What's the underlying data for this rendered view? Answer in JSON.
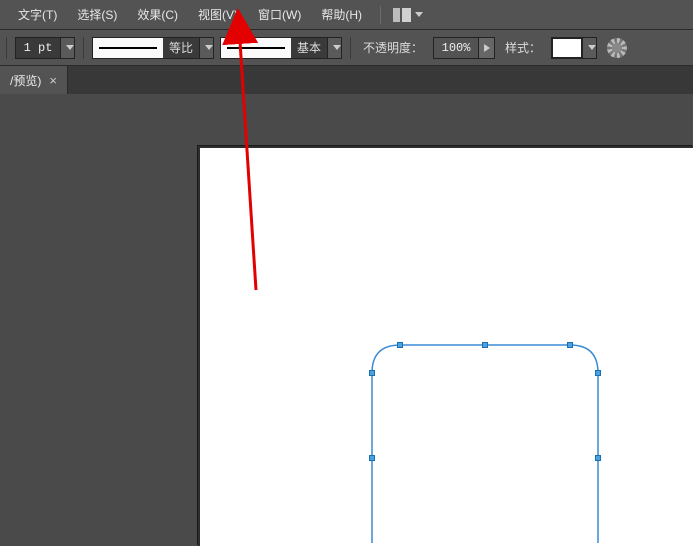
{
  "menu": {
    "items": [
      "文字(T)",
      "选择(S)",
      "效果(C)",
      "视图(V)",
      "窗口(W)",
      "帮助(H)"
    ]
  },
  "options": {
    "stroke_width": "1 pt",
    "dash1_label": "等比",
    "dash2_label": "基本",
    "opacity_label": "不透明度：",
    "opacity_value": "100%",
    "style_label": "样式："
  },
  "tab": {
    "title": "/预览)"
  }
}
